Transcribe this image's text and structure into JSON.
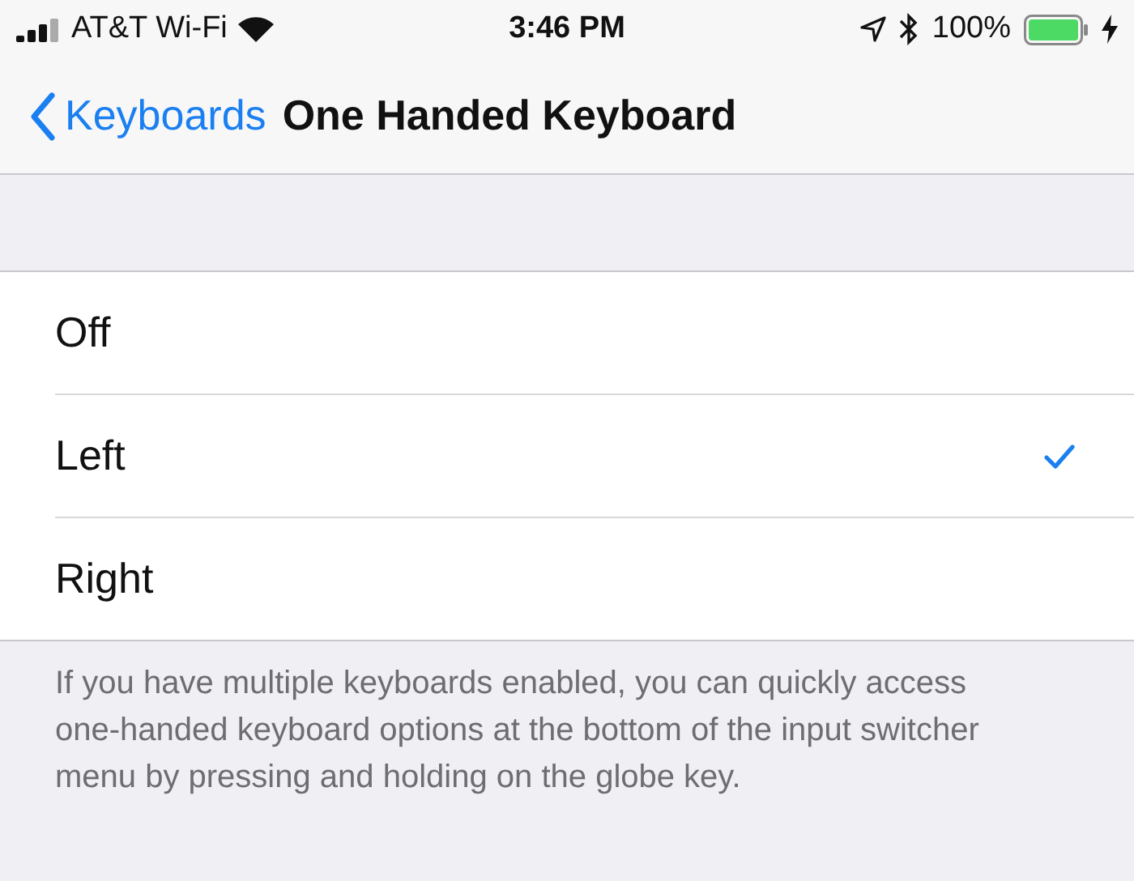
{
  "status_bar": {
    "carrier": "AT&T Wi-Fi",
    "time": "3:46 PM",
    "battery": "100%"
  },
  "nav": {
    "back": "Keyboards",
    "title": "One Handed Keyboard"
  },
  "options": [
    {
      "label": "Off",
      "selected": false
    },
    {
      "label": "Left",
      "selected": true
    },
    {
      "label": "Right",
      "selected": false
    }
  ],
  "footer": "If you have multiple keyboards enabled, you can quickly access one-handed keyboard options at the bottom of the input switcher menu by pressing and holding on the globe key."
}
